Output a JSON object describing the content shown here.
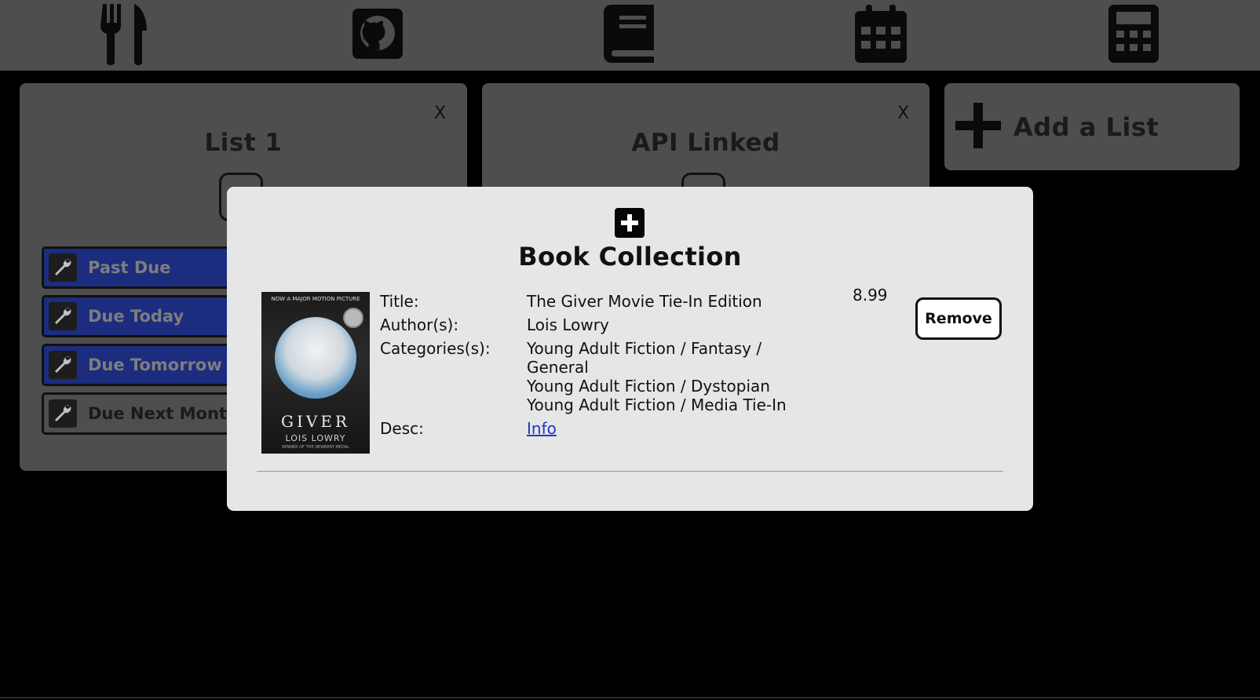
{
  "nav": {
    "items": [
      {
        "name": "utensils-icon"
      },
      {
        "name": "github-icon"
      },
      {
        "name": "book-icon"
      },
      {
        "name": "calendar-icon"
      },
      {
        "name": "calculator-icon"
      }
    ]
  },
  "lists": [
    {
      "title": "List 1",
      "close_label": "X",
      "filters": [
        "Past Due",
        "Due Today",
        "Due Tomorrow",
        "Due Next Month"
      ]
    },
    {
      "title": "API Linked",
      "close_label": "X"
    }
  ],
  "add_list": {
    "label": "Add a List"
  },
  "modal": {
    "title": "Book Collection",
    "book": {
      "cover": {
        "tagline": "NOW A MAJOR MOTION PICTURE",
        "title": "GIVER",
        "author": "LOIS LOWRY",
        "footer": "WINNER OF THE NEWBERY MEDAL"
      },
      "labels": {
        "title": "Title:",
        "authors": "Author(s):",
        "categories": "Categories(s):",
        "desc": "Desc:"
      },
      "title": "The Giver Movie Tie-In Edition",
      "authors": "Lois Lowry",
      "categories": [
        "Young Adult Fiction / Fantasy /",
        "General",
        "Young Adult Fiction / Dystopian",
        "Young Adult Fiction / Media Tie-In"
      ],
      "desc_link": "Info",
      "price": "8.99",
      "remove_label": "Remove"
    }
  },
  "colors": {
    "topbar": "#4e4e4e",
    "card": "#4e4e4e",
    "filter_blue": "#1c2c7e",
    "modal_bg": "#e6e6e6",
    "link": "#1a39c7"
  }
}
